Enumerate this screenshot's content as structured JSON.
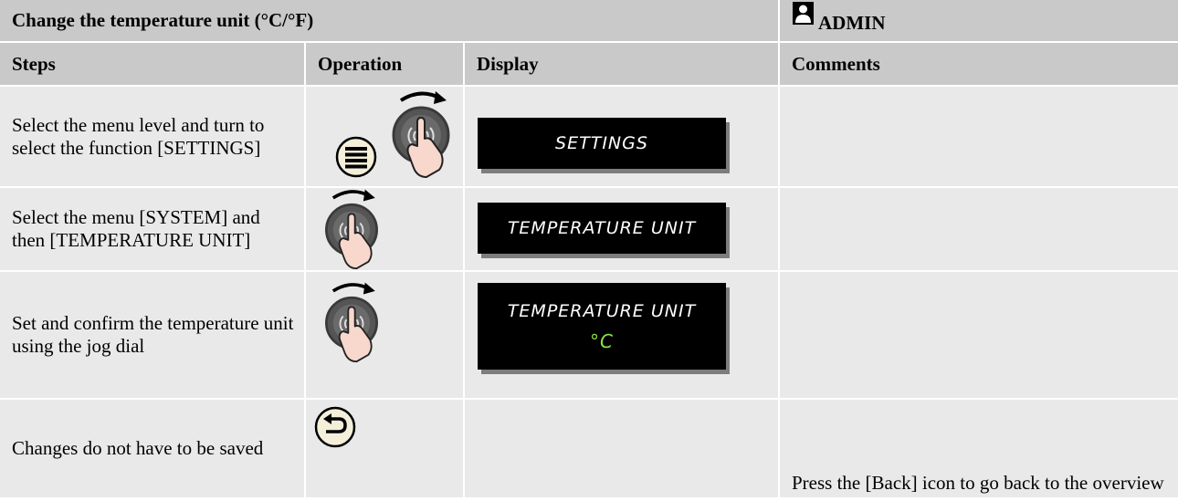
{
  "header": {
    "title": "Change the temperature unit (°C/°F)",
    "role": "ADMIN"
  },
  "columns": {
    "steps": "Steps",
    "operation": "Operation",
    "display": "Display",
    "comments": "Comments"
  },
  "rows": [
    {
      "step": "Select the menu level and turn to select the function [SETTINGS]",
      "operation_icons": [
        "menu-button-icon",
        "jog-dial-turn-icon"
      ],
      "display_line1": "SETTINGS",
      "display_line2": "",
      "comment": ""
    },
    {
      "step": "Select the menu [SYSTEM] and then [TEMPERATURE UNIT]",
      "operation_icons": [
        "jog-dial-turn-icon"
      ],
      "display_line1": "TEMPERATURE UNIT",
      "display_line2": "",
      "comment": ""
    },
    {
      "step": "Set and confirm the temperature unit using the jog dial",
      "operation_icons": [
        "jog-dial-turn-icon"
      ],
      "display_line1": "TEMPERATURE UNIT",
      "display_line2": "°C",
      "comment": ""
    },
    {
      "step": "Changes do not have to be saved",
      "operation_icons": [
        "back-button-icon"
      ],
      "display_line1": "",
      "display_line2": "",
      "comment": "Press the [Back] icon to go back to the overview"
    }
  ],
  "colors": {
    "header_bg": "#c9c9c9",
    "body_bg": "#e9e9e9",
    "lcd_bg": "#000000",
    "lcd_text": "#ffffff",
    "lcd_value": "#88e24a",
    "button_fill": "#f4efd9"
  }
}
